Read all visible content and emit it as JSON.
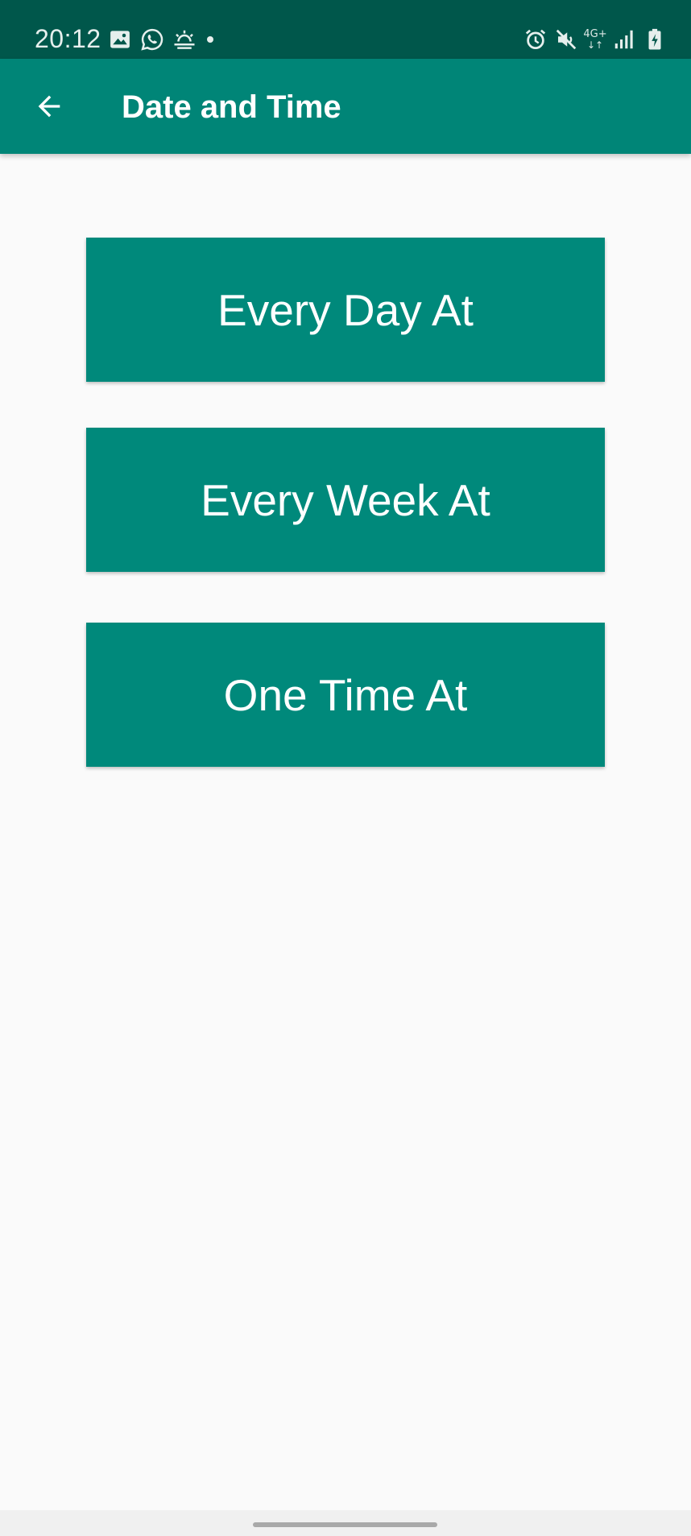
{
  "status_bar": {
    "time": "20:12",
    "network_label": "4G+",
    "left_icons": [
      "image-icon",
      "whatsapp-icon",
      "weather-icon",
      "notification-dot-icon"
    ],
    "right_icons": [
      "alarm-icon",
      "mute-icon",
      "network-4g-icon",
      "signal-icon",
      "battery-charging-icon"
    ]
  },
  "app_bar": {
    "back_icon": "arrow-back-icon",
    "title": "Date and Time"
  },
  "buttons": [
    {
      "label": "Every Day At"
    },
    {
      "label": "Every Week At"
    },
    {
      "label": "One Time At"
    }
  ],
  "colors": {
    "status_bar": "#00574b",
    "app_bar": "#008577",
    "button": "#00897b",
    "background": "#fafafa"
  }
}
